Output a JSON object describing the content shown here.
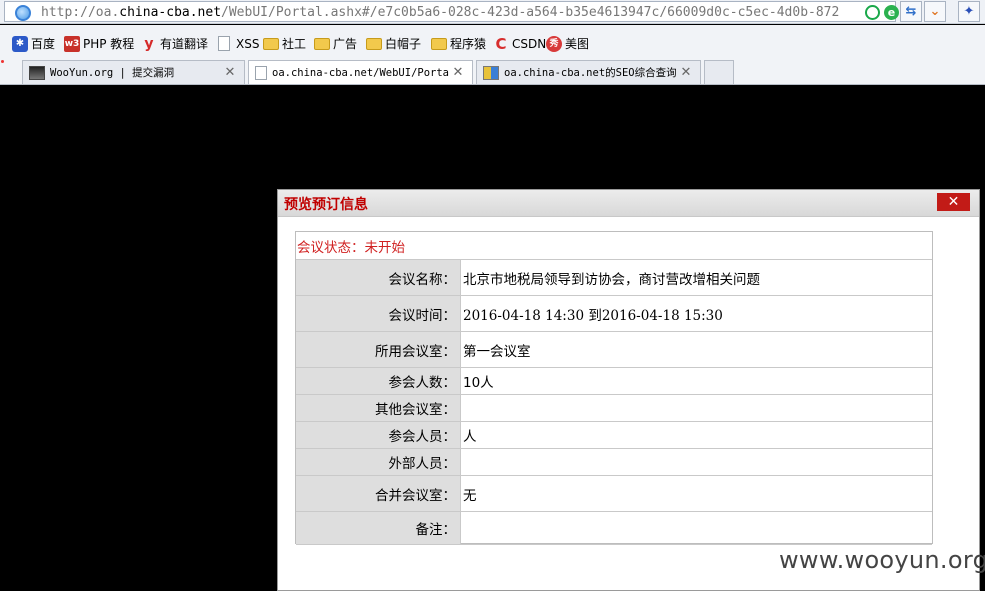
{
  "browser": {
    "url_prefix": "http://oa.",
    "url_host": "china-cba.net",
    "url_rest": "/WebUI/Portal.ashx#/e7c0b5a6-028c-423d-a564-b35e4613947c/66009d0c-c5ec-4d0b-872",
    "bookmarks": [
      {
        "label": "百度",
        "icon": "paw-icon"
      },
      {
        "label": "PHP 教程",
        "icon": "w3-icon",
        "icon_text": "w3"
      },
      {
        "label": "有道翻译",
        "icon": "youdao-icon",
        "icon_text": "y"
      },
      {
        "label": "XSS",
        "icon": "page-icon"
      },
      {
        "label": "社工",
        "icon": "folder-icon"
      },
      {
        "label": "广告",
        "icon": "folder-icon"
      },
      {
        "label": "白帽子",
        "icon": "folder-icon"
      },
      {
        "label": "程序猿",
        "icon": "folder-icon"
      },
      {
        "label": "CSDN",
        "icon": "csdn-icon",
        "icon_text": "C"
      },
      {
        "label": "美图",
        "icon": "meitu-icon",
        "icon_text": "秀"
      }
    ],
    "tabs": [
      {
        "title": "WooYun.org | 提交漏洞",
        "active": false
      },
      {
        "title": "oa.china-cba.net/WebUI/Porta",
        "active": true
      },
      {
        "title": "oa.china-cba.net的SEO综合查询",
        "active": false
      }
    ]
  },
  "dialog": {
    "title": "预览预订信息",
    "close_label": "✕",
    "status": "会议状态：未开始",
    "rows": [
      {
        "label": "会议名称：",
        "value": "北京市地税局领导到访协会，商讨营改增相关问题"
      },
      {
        "label": "会议时间：",
        "value": "2016-04-18 14:30 到2016-04-18 15:30"
      },
      {
        "label": "所用会议室：",
        "value": "第一会议室"
      },
      {
        "label": "参会人数：",
        "value": "10人"
      },
      {
        "label": "其他会议室：",
        "value": ""
      },
      {
        "label": "参会人员：",
        "value": "人"
      },
      {
        "label": "外部人员：",
        "value": ""
      },
      {
        "label": "合并会议室：",
        "value": "无"
      },
      {
        "label": "备注：",
        "value": ""
      }
    ]
  },
  "watermark": "www.wooyun.org"
}
